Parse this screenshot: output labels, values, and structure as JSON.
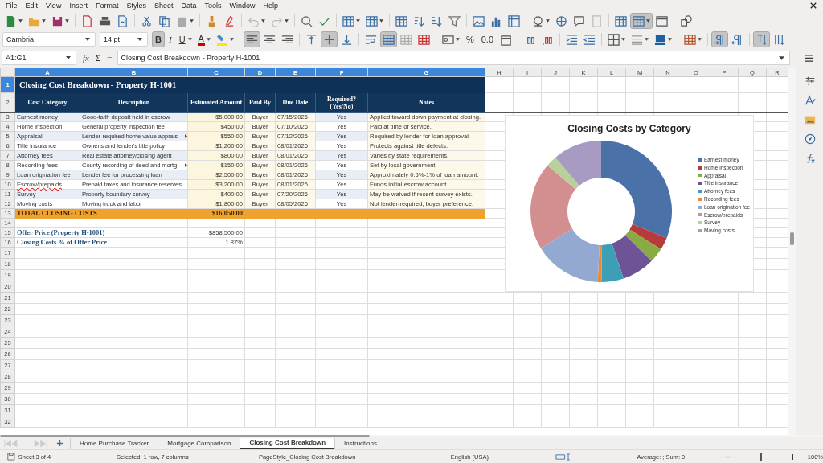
{
  "menu": [
    "File",
    "Edit",
    "View",
    "Insert",
    "Format",
    "Styles",
    "Sheet",
    "Data",
    "Tools",
    "Window",
    "Help"
  ],
  "toolbar_standard": [
    [
      {
        "kind": "new",
        "pressed": false
      },
      {
        "kind": "open",
        "pressed": false
      },
      {
        "kind": "save",
        "pressed": false
      }
    ],
    [
      {
        "kind": "pdf",
        "pressed": false
      },
      {
        "kind": "print",
        "pressed": false
      },
      {
        "kind": "preview",
        "pressed": false
      }
    ],
    [
      {
        "kind": "cut",
        "pressed": false
      },
      {
        "kind": "copy",
        "pressed": false
      },
      {
        "kind": "paste",
        "pressed": false
      }
    ],
    [
      {
        "kind": "clone",
        "pressed": false
      },
      {
        "kind": "clear",
        "pressed": false
      }
    ],
    [
      {
        "kind": "undo",
        "pressed": false
      },
      {
        "kind": "redo",
        "pressed": false
      }
    ],
    [
      {
        "kind": "find",
        "pressed": false
      },
      {
        "kind": "spell",
        "pressed": false
      }
    ],
    [
      {
        "kind": "row",
        "pressed": false
      },
      {
        "kind": "column",
        "pressed": false
      }
    ],
    [
      {
        "kind": "sort",
        "pressed": false
      },
      {
        "kind": "sortasc",
        "pressed": false
      },
      {
        "kind": "sortdesc",
        "pressed": false
      },
      {
        "kind": "filter",
        "pressed": false
      }
    ],
    [
      {
        "kind": "image",
        "pressed": false
      },
      {
        "kind": "chart",
        "pressed": false
      },
      {
        "kind": "pivot",
        "pressed": false
      }
    ],
    [
      {
        "kind": "special",
        "pressed": false
      },
      {
        "kind": "link",
        "pressed": false
      },
      {
        "kind": "comment",
        "pressed": false
      },
      {
        "kind": "headerfooter",
        "pressed": false
      }
    ],
    [
      {
        "kind": "printrange",
        "pressed": false
      },
      {
        "kind": "freeze",
        "pressed": true
      },
      {
        "kind": "split",
        "pressed": false
      }
    ],
    [
      {
        "kind": "shapes",
        "pressed": false
      }
    ]
  ],
  "font_name": "Cambria",
  "font_size": "14 pt",
  "toolbar_format": [
    [
      {
        "kind": "bold",
        "glyph": "B",
        "pressed": true
      },
      {
        "kind": "italic",
        "glyph": "I",
        "pressed": false
      },
      {
        "kind": "underline",
        "glyph": "U",
        "pressed": false
      },
      {
        "kind": "fontcolor",
        "glyph": "A",
        "pressed": false
      },
      {
        "kind": "highlight",
        "pressed": false
      }
    ],
    [
      {
        "kind": "alignleft",
        "pressed": true
      },
      {
        "kind": "aligncenter",
        "pressed": false
      },
      {
        "kind": "alignright",
        "pressed": false
      }
    ],
    [
      {
        "kind": "top",
        "pressed": false
      },
      {
        "kind": "vcenter",
        "pressed": true
      },
      {
        "kind": "bottom",
        "pressed": false
      }
    ],
    [
      {
        "kind": "wrap",
        "pressed": false
      },
      {
        "kind": "merge",
        "pressed": true
      },
      {
        "kind": "unmerge",
        "pressed": false
      },
      {
        "kind": "splitcells",
        "pressed": false
      }
    ],
    [
      {
        "kind": "currency",
        "pressed": false
      },
      {
        "kind": "percent",
        "glyph": "%",
        "pressed": false
      },
      {
        "kind": "number",
        "glyph": "0.0",
        "pressed": false
      },
      {
        "kind": "date",
        "pressed": false
      }
    ],
    [
      {
        "kind": "adddec",
        "pressed": false
      },
      {
        "kind": "deldec",
        "pressed": false
      }
    ],
    [
      {
        "kind": "indent",
        "pressed": false
      },
      {
        "kind": "outdent",
        "pressed": false
      }
    ],
    [
      {
        "kind": "borders",
        "pressed": false
      },
      {
        "kind": "borderstyle",
        "pressed": false
      },
      {
        "kind": "bordercolor",
        "pressed": false
      }
    ],
    [
      {
        "kind": "condfmt",
        "pressed": false
      }
    ],
    [
      {
        "kind": "ltr",
        "pressed": true
      },
      {
        "kind": "rtl",
        "pressed": false
      }
    ],
    [
      {
        "kind": "vert1",
        "pressed": true
      },
      {
        "kind": "vert2",
        "pressed": false
      }
    ]
  ],
  "name_box": "A1:G1",
  "formula_buttons": [
    "fx",
    "Σ",
    "="
  ],
  "formula": "Closing Cost Breakdown - Property H-1001",
  "columns": [
    {
      "label": "A",
      "selected": true
    },
    {
      "label": "B",
      "selected": true
    },
    {
      "label": "C",
      "selected": true
    },
    {
      "label": "D",
      "selected": true
    },
    {
      "label": "E",
      "selected": true
    },
    {
      "label": "F",
      "selected": true
    },
    {
      "label": "G",
      "selected": true
    },
    {
      "label": "H",
      "selected": false
    },
    {
      "label": "I",
      "selected": false
    },
    {
      "label": "J",
      "selected": false
    },
    {
      "label": "K",
      "selected": false
    },
    {
      "label": "L",
      "selected": false
    },
    {
      "label": "M",
      "selected": false
    },
    {
      "label": "N",
      "selected": false
    },
    {
      "label": "O",
      "selected": false
    },
    {
      "label": "P",
      "selected": false
    },
    {
      "label": "Q",
      "selected": false
    },
    {
      "label": "R",
      "selected": false
    }
  ],
  "row_numbers": [
    {
      "label": "1",
      "selected": true
    },
    {
      "label": "2",
      "selected": false
    },
    {
      "label": "3",
      "selected": false
    },
    {
      "label": "4",
      "selected": false
    },
    {
      "label": "5",
      "selected": false
    },
    {
      "label": "6",
      "selected": false
    },
    {
      "label": "7",
      "selected": false
    },
    {
      "label": "8",
      "selected": false
    },
    {
      "label": "9",
      "selected": false
    },
    {
      "label": "10",
      "selected": false
    },
    {
      "label": "11",
      "selected": false
    },
    {
      "label": "12",
      "selected": false
    },
    {
      "label": "13",
      "selected": false
    },
    {
      "label": "14",
      "selected": false
    },
    {
      "label": "15",
      "selected": false
    },
    {
      "label": "16",
      "selected": false
    },
    {
      "label": "17",
      "selected": false
    },
    {
      "label": "18",
      "selected": false
    },
    {
      "label": "19",
      "selected": false
    },
    {
      "label": "20",
      "selected": false
    },
    {
      "label": "21",
      "selected": false
    },
    {
      "label": "22",
      "selected": false
    },
    {
      "label": "23",
      "selected": false
    },
    {
      "label": "24",
      "selected": false
    },
    {
      "label": "25",
      "selected": false
    },
    {
      "label": "26",
      "selected": false
    },
    {
      "label": "27",
      "selected": false
    },
    {
      "label": "28",
      "selected": false
    },
    {
      "label": "29",
      "selected": false
    },
    {
      "label": "30",
      "selected": false
    },
    {
      "label": "31",
      "selected": false
    },
    {
      "label": "32",
      "selected": false
    }
  ],
  "sheet": {
    "title": "Closing Cost Breakdown - Property H-1001",
    "headers": [
      "Cost Category",
      "Description",
      "Estimated Amount",
      "Paid By",
      "Due Date",
      "Required? (Yes/No)",
      "Notes"
    ],
    "rows": [
      {
        "category": "Earnest money",
        "misspelled": false,
        "description": "Good-faith deposit held in escrow",
        "cut": false,
        "amount": "$5,000.00",
        "paid_by": "Buyer",
        "due_date": "07/15/2026",
        "required": "Yes",
        "notes": "Applied toward down payment at closing."
      },
      {
        "category": "Home inspection",
        "misspelled": false,
        "description": "General property inspection fee",
        "cut": false,
        "amount": "$450.00",
        "paid_by": "Buyer",
        "due_date": "07/10/2026",
        "required": "Yes",
        "notes": "Paid at time of service."
      },
      {
        "category": "Appraisal",
        "misspelled": false,
        "description": "Lender-required home value apprais",
        "cut": true,
        "amount": "$550.00",
        "paid_by": "Buyer",
        "due_date": "07/12/2026",
        "required": "Yes",
        "notes": "Required by lender for loan approval."
      },
      {
        "category": "Title insurance",
        "misspelled": false,
        "description": "Owner's and lender's title policy",
        "cut": false,
        "amount": "$1,200.00",
        "paid_by": "Buyer",
        "due_date": "08/01/2026",
        "required": "Yes",
        "notes": "Protects against title defects."
      },
      {
        "category": "Attorney fees",
        "misspelled": false,
        "description": "Real estate attorney/closing agent",
        "cut": false,
        "amount": "$800.00",
        "paid_by": "Buyer",
        "due_date": "08/01/2026",
        "required": "Yes",
        "notes": "Varies by state requirements."
      },
      {
        "category": "Recording fees",
        "misspelled": false,
        "description": "County recording of deed and mortg",
        "cut": true,
        "amount": "$150.00",
        "paid_by": "Buyer",
        "due_date": "08/01/2026",
        "required": "Yes",
        "notes": "Set by local government."
      },
      {
        "category": "Loan origination fee",
        "misspelled": false,
        "description": "Lender fee for processing loan",
        "cut": false,
        "amount": "$2,500.00",
        "paid_by": "Buyer",
        "due_date": "08/01/2026",
        "required": "Yes",
        "notes": "Approximately 0.5%-1% of loan amount."
      },
      {
        "category": "Escrow/prepaids",
        "misspelled": true,
        "description": "Prepaid taxes and insurance reserves",
        "cut": false,
        "amount": "$3,200.00",
        "paid_by": "Buyer",
        "due_date": "08/01/2026",
        "required": "Yes",
        "notes": "Funds initial escrow account."
      },
      {
        "category": "Survey",
        "misspelled": false,
        "description": "Property boundary survey",
        "cut": false,
        "amount": "$400.00",
        "paid_by": "Buyer",
        "due_date": "07/20/2026",
        "required": "Yes",
        "notes": "May be waived if recent survey exists."
      },
      {
        "category": "Moving costs",
        "misspelled": false,
        "description": "Moving truck and labor",
        "cut": false,
        "amount": "$1,800.00",
        "paid_by": "Buyer",
        "due_date": "08/05/2026",
        "required": "Yes",
        "notes": "Not lender-required; buyer preference."
      }
    ],
    "total_label": "TOTAL CLOSING COSTS",
    "total_amount": "$16,050.00",
    "offer_label": "Offer Price (Property H-1001)",
    "offer_value": "$858,500.00",
    "percent_label": "Closing Costs % of Offer Price",
    "percent_value": "1.87%"
  },
  "chart": {
    "chart_data": {
      "type": "donut",
      "title": "Closing Costs by Category",
      "series": [
        {
          "values": [
            31.16,
            2.8,
            3.43,
            7.48,
            4.98,
            0.93,
            15.58,
            19.94,
            2.49,
            11.21
          ]
        }
      ]
    },
    "legend": [
      {
        "label": "Earnest money",
        "color": "#4a72a8"
      },
      {
        "label": "Home inspection",
        "color": "#b93a3a"
      },
      {
        "label": "Appraisal",
        "color": "#8aab43"
      },
      {
        "label": "Title insurance",
        "color": "#6e5496"
      },
      {
        "label": "Attorney fees",
        "color": "#3d9fb5"
      },
      {
        "label": "Recording fees",
        "color": "#e68a36"
      },
      {
        "label": "Loan origination fee",
        "color": "#93a9d2"
      },
      {
        "label": "Escrow/prepaids",
        "color": "#d38f8f"
      },
      {
        "label": "Survey",
        "color": "#b8d19a"
      },
      {
        "label": "Moving costs",
        "color": "#a79bc3"
      }
    ]
  },
  "sheet_tabs": [
    {
      "label": "Home Purchase Tracker",
      "selected": false
    },
    {
      "label": "Mortgage Comparison",
      "selected": false
    },
    {
      "label": "Closing Cost Breakdown",
      "selected": true
    },
    {
      "label": "Instructions",
      "selected": false
    }
  ],
  "status_bar": {
    "sheet": "Sheet 3 of 4",
    "selection": "Selected: 1 row, 7 columns",
    "page_style": "PageStyle_Closing Cost Breakdown",
    "language": "English (USA)",
    "summary": "Average: ; Sum: 0",
    "zoom_slider": {
      "level": 0.5
    },
    "zoom": "100%"
  }
}
